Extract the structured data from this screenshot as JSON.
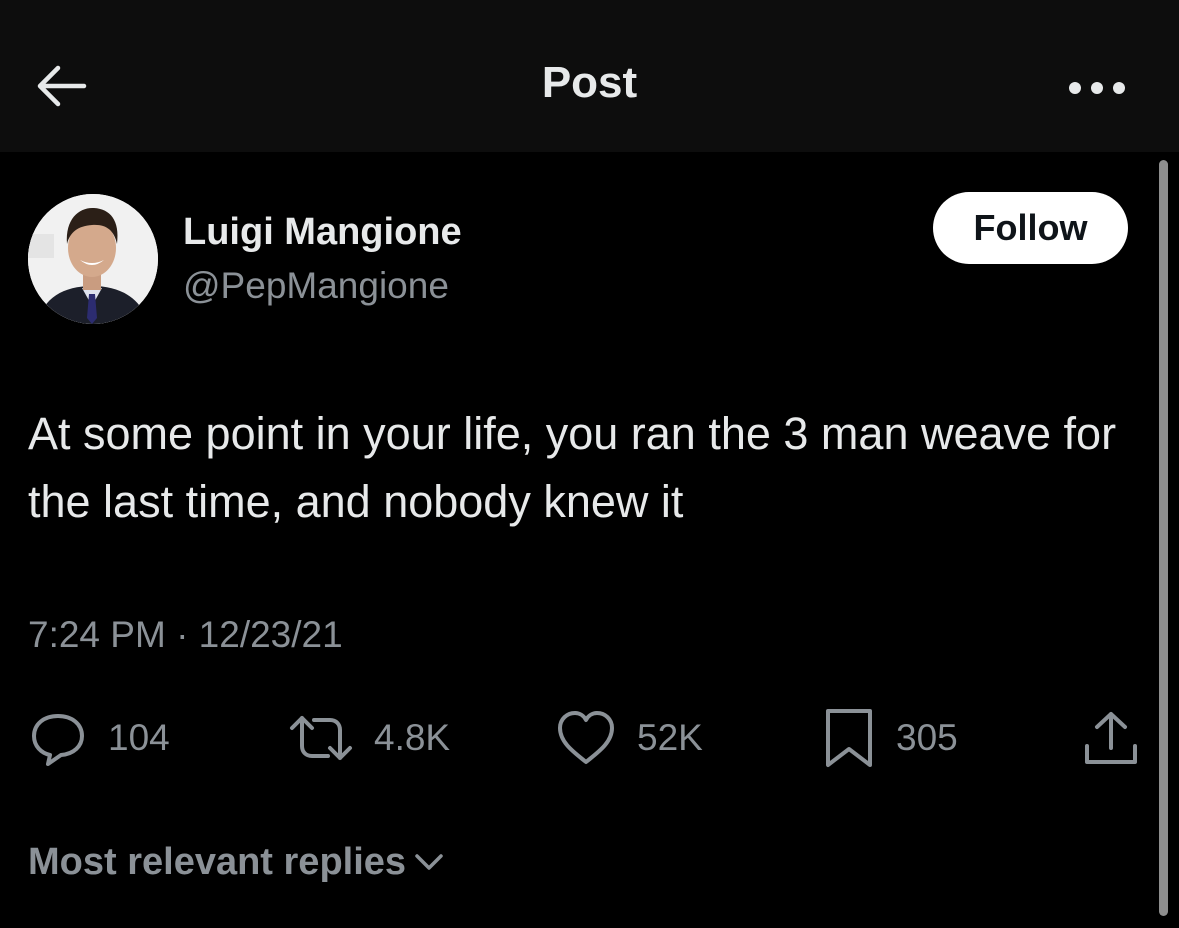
{
  "header": {
    "title": "Post",
    "back_icon": "arrow-left-icon",
    "more_icon": "more-horizontal-icon"
  },
  "author": {
    "name": "Luigi Mangione",
    "handle": "@PepMangione",
    "follow_label": "Follow"
  },
  "post": {
    "text": "At some point in your life, you ran the 3 man weave for the last time, and nobody knew it",
    "meta": "7:24 PM · 12/23/21"
  },
  "actions": {
    "replies": {
      "icon": "reply-icon",
      "count": "104"
    },
    "reposts": {
      "icon": "repost-icon",
      "count": "4.8K"
    },
    "likes": {
      "icon": "heart-icon",
      "count": "52K"
    },
    "bookmarks": {
      "icon": "bookmark-icon",
      "count": "305"
    },
    "share": {
      "icon": "share-icon"
    }
  },
  "replies_sort": {
    "label": "Most relevant replies"
  },
  "colors": {
    "background": "#000000",
    "header_bg": "#0d0d0d",
    "primary_text": "#e7e9ea",
    "secondary_text": "#8b9197",
    "follow_bg": "#ffffff",
    "follow_text": "#0f1419"
  }
}
